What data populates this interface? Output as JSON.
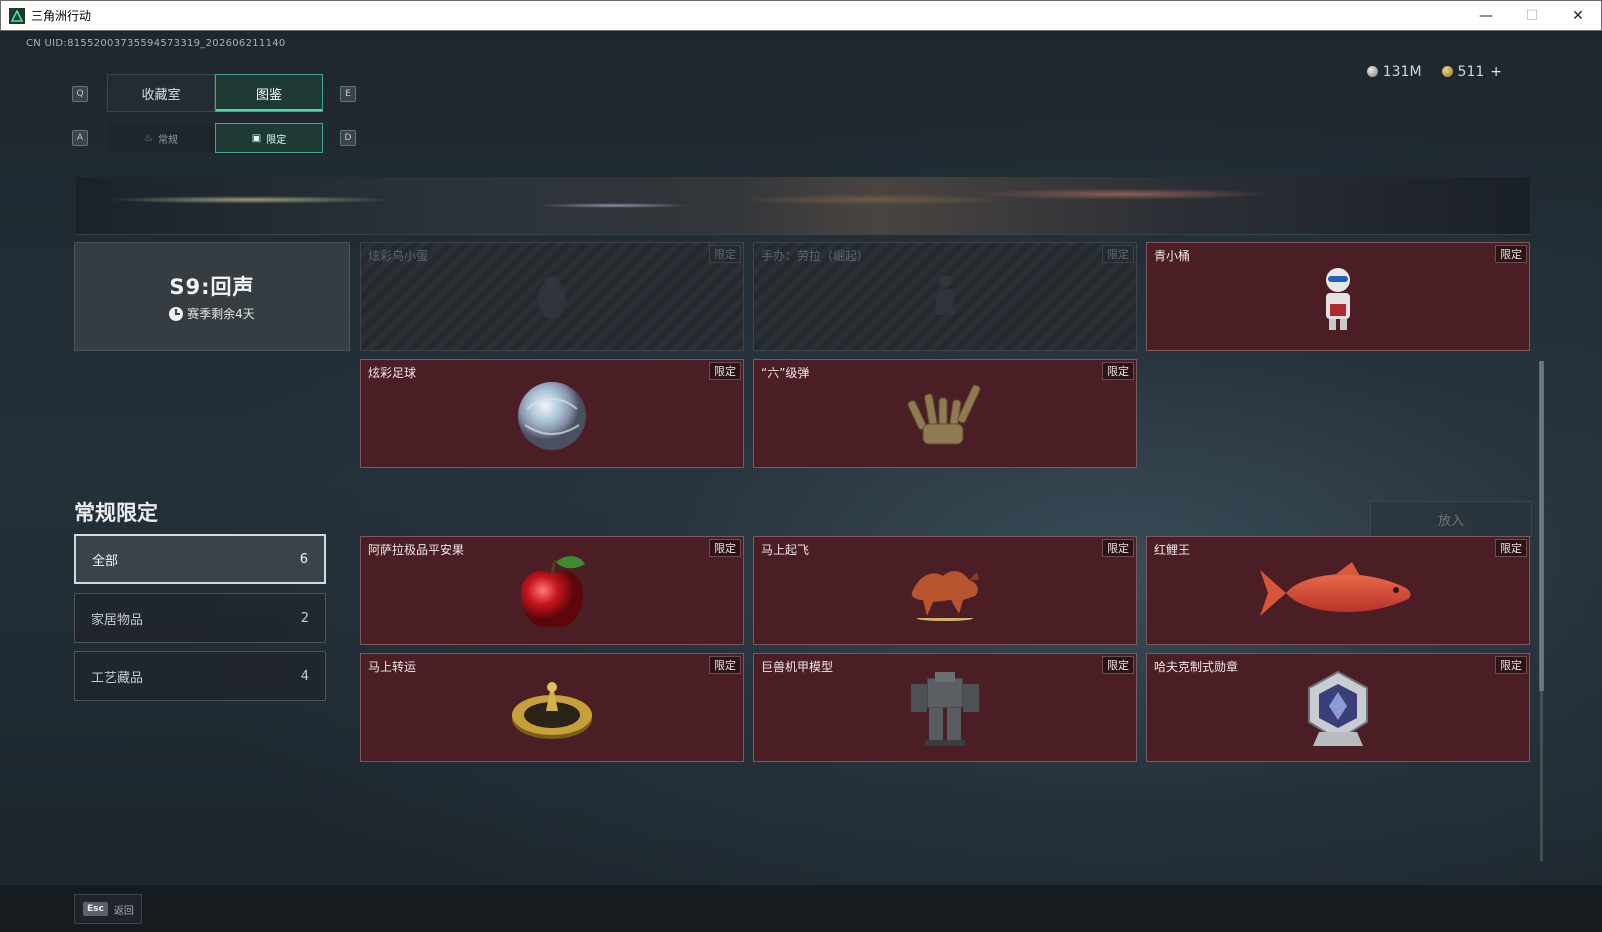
{
  "window": {
    "title": "三角洲行动",
    "controls": [
      "—",
      "☐",
      "✕"
    ]
  },
  "uid": "CN UID:8155200373559457331​9_202606211140",
  "currency": {
    "silver": "131M",
    "gold": "511",
    "plus": "+"
  },
  "keys": {
    "prev_tab": "Q",
    "next_tab": "E",
    "prev_sub": "A",
    "next_sub": "D"
  },
  "tabs": {
    "collection_room": "收藏室",
    "codex": "图鉴"
  },
  "subtabs": {
    "regular": "常规",
    "limited": "限定"
  },
  "season": {
    "title": "S9:回声",
    "remaining": "赛季剩余4天"
  },
  "limited_tag": "限定",
  "season_items": [
    {
      "name": "炫彩乌小蛋",
      "locked": true
    },
    {
      "name": "手办：劳拉（崛起）",
      "locked": true
    },
    {
      "name": "青小桶",
      "locked": false
    },
    {
      "name": "炫彩足球",
      "locked": false
    },
    {
      "name": "“六”级弹",
      "locked": false
    }
  ],
  "section": {
    "title": "常规限定",
    "place_button": "放入"
  },
  "filters": [
    {
      "label": "全部",
      "count": "6"
    },
    {
      "label": "家居物品",
      "count": "2"
    },
    {
      "label": "工艺藏品",
      "count": "4"
    }
  ],
  "regular_items": [
    {
      "name": "阿萨拉极品平安果"
    },
    {
      "name": "马上起飞"
    },
    {
      "name": "红鲤王"
    },
    {
      "name": "马上转运"
    },
    {
      "name": "巨兽机甲模型"
    },
    {
      "name": "哈夫克制式勋章"
    }
  ],
  "footer": {
    "esc_key": "Esc",
    "back_label": "返回"
  },
  "colors": {
    "accent": "#3fa88b",
    "card_bg": "#4a1e24",
    "card_border": "#7b5a5e"
  }
}
